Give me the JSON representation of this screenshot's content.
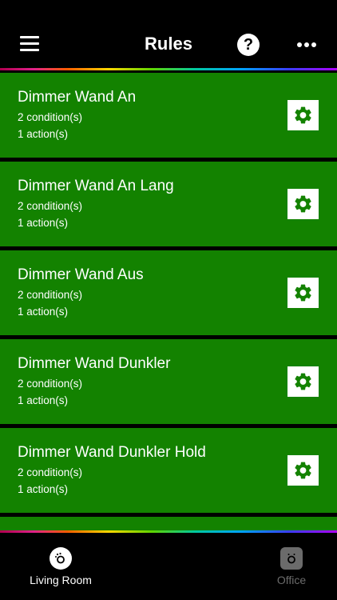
{
  "header": {
    "title": "Rules",
    "help_symbol": "?",
    "icons": [
      "hamburger-menu-icon",
      "help-icon",
      "more-options-icon"
    ]
  },
  "rules": [
    {
      "name": "Dimmer Wand An",
      "conditions": "2 condition(s)",
      "actions": "1 action(s)"
    },
    {
      "name": "Dimmer Wand An Lang",
      "conditions": "2 condition(s)",
      "actions": "1 action(s)"
    },
    {
      "name": "Dimmer Wand Aus",
      "conditions": "2 condition(s)",
      "actions": "1 action(s)"
    },
    {
      "name": "Dimmer Wand Dunkler",
      "conditions": "2 condition(s)",
      "actions": "1 action(s)"
    },
    {
      "name": "Dimmer Wand Dunkler Hold",
      "conditions": "2 condition(s)",
      "actions": "1 action(s)"
    }
  ],
  "tabs": [
    {
      "label": "Living Room",
      "active": true,
      "icon": "living-room-icon"
    },
    {
      "label": "Office",
      "active": false,
      "icon": "office-icon"
    }
  ],
  "colors": {
    "background": "#000000",
    "rule_card": "#138200",
    "text": "#ffffff",
    "inactive_tab": "#6b6b6b"
  }
}
